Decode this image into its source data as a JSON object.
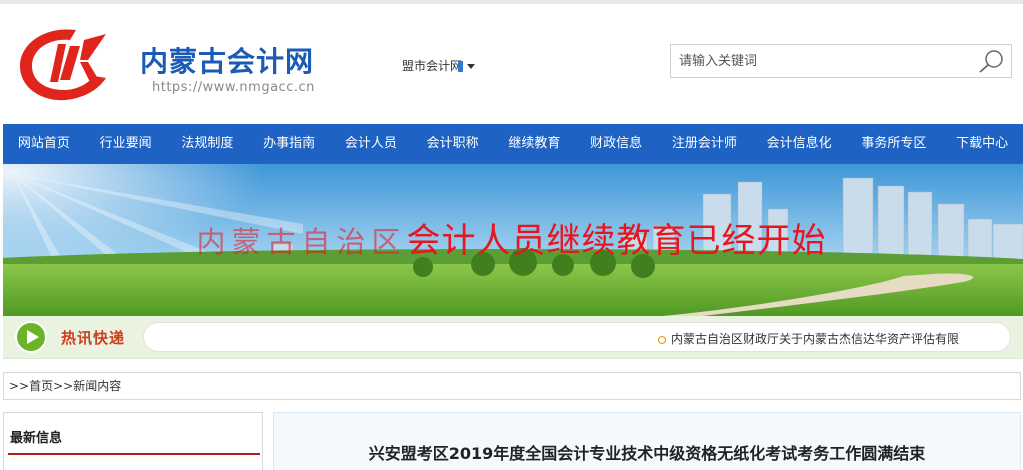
{
  "header": {
    "site_name": "内蒙古会计网",
    "site_url": "https://www.nmgacc.cn",
    "city_select_label": "盟市会计网",
    "search_placeholder": "请输入关键词"
  },
  "nav": {
    "items": [
      {
        "label": "网站首页"
      },
      {
        "label": "行业要闻"
      },
      {
        "label": "法规制度"
      },
      {
        "label": "办事指南"
      },
      {
        "label": "会计人员"
      },
      {
        "label": "会计职称"
      },
      {
        "label": "继续教育"
      },
      {
        "label": "财政信息"
      },
      {
        "label": "注册会计师"
      },
      {
        "label": "会计信息化"
      },
      {
        "label": "事务所专区"
      },
      {
        "label": "下载中心"
      }
    ]
  },
  "banner": {
    "headline_part1": "内蒙古自治区",
    "headline_part2": "会计人员继续教育已经开始"
  },
  "ticker": {
    "label": "热讯快递",
    "news": "内蒙古自治区财政厅关于内蒙古杰信达华资产评估有限"
  },
  "breadcrumb": {
    "sep1": ">>",
    "home": "首页",
    "sep2": ">>",
    "current": "新闻内容"
  },
  "sidebar": {
    "title": "最新信息"
  },
  "article": {
    "title": "兴安盟考区2019年度全国会计专业技术中级资格无纸化考试考务工作圆满结束"
  },
  "colors": {
    "brand_blue": "#1e63c4",
    "logo_red": "#e0261c",
    "banner_text_red": "#e8141e",
    "accent_rule": "#b31b1b"
  },
  "icons": {
    "logo": "logo-mark",
    "search": "search-icon",
    "ticker": "play-icon"
  }
}
